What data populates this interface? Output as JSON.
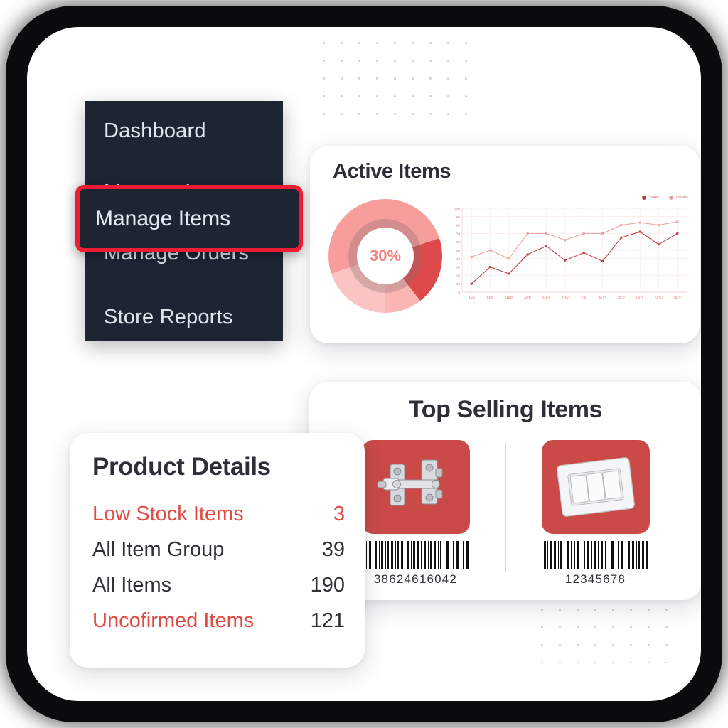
{
  "sidebar": {
    "items": [
      {
        "label": "Dashboard",
        "name": "dashboard",
        "selected": false
      },
      {
        "label": "Manage Items",
        "name": "manage-items",
        "selected": true
      },
      {
        "label": "Manage Orders",
        "name": "manage-orders",
        "selected": false
      },
      {
        "label": "Store Reports",
        "name": "store-reports",
        "selected": false
      }
    ],
    "background_color": "#1d2533",
    "selection_border_color": "#ee1c33"
  },
  "active_items_card": {
    "title": "Active Items",
    "donut": {
      "center_label": "30%",
      "percent": 30,
      "colors": [
        "#dc4a4a",
        "#f79d9c",
        "#fac4c2",
        "#fbb5b3"
      ]
    }
  },
  "chart_data": {
    "type": "line",
    "title": "Active Items",
    "xlabel": "",
    "ylabel": "",
    "grid": true,
    "legend_position": "top-right",
    "categories": [
      "JAN",
      "FEB",
      "MAR",
      "APR",
      "MAY",
      "JUN",
      "JUL",
      "AUG",
      "SEP",
      "OCT",
      "NOV",
      "DEC"
    ],
    "x_tick_labels": [
      "JAN",
      "FEB",
      "MAR",
      "APR",
      "MAY",
      "JUN",
      "JUL",
      "AUG",
      "SEP",
      "OCT",
      "NOV",
      "DEC"
    ],
    "y_tick_labels": [
      "100",
      "90",
      "80",
      "70",
      "60",
      "50",
      "40",
      "30",
      "20",
      "10",
      "0"
    ],
    "ylim": [
      0,
      100
    ],
    "series": [
      {
        "name": "Sales",
        "color": "#c23d3f",
        "values": [
          10,
          30,
          22,
          45,
          55,
          38,
          47,
          37,
          65,
          72,
          57,
          70
        ]
      },
      {
        "name": "Orders",
        "color": "#eda2a1",
        "values": [
          42,
          50,
          40,
          70,
          70,
          62,
          70,
          70,
          80,
          83,
          80,
          84
        ]
      }
    ]
  },
  "top_selling_card": {
    "title": "Top Selling Items",
    "products": [
      {
        "name": "door-latch-bolt",
        "barcode_number": "38624616042",
        "tile_color": "#c94a47"
      },
      {
        "name": "wall-light-switch",
        "barcode_number": "12345678",
        "tile_color": "#c94a47"
      }
    ]
  },
  "product_details_card": {
    "title": "Product Details",
    "rows": [
      {
        "label": "Low Stock Items",
        "value": "3",
        "label_accent": true,
        "value_accent": true
      },
      {
        "label": "All Item Group",
        "value": "39",
        "label_accent": false,
        "value_accent": false
      },
      {
        "label": "All Items",
        "value": "190",
        "label_accent": false,
        "value_accent": false
      },
      {
        "label": "Uncofirmed Items",
        "value": "121",
        "label_accent": true,
        "value_accent": false
      }
    ]
  }
}
